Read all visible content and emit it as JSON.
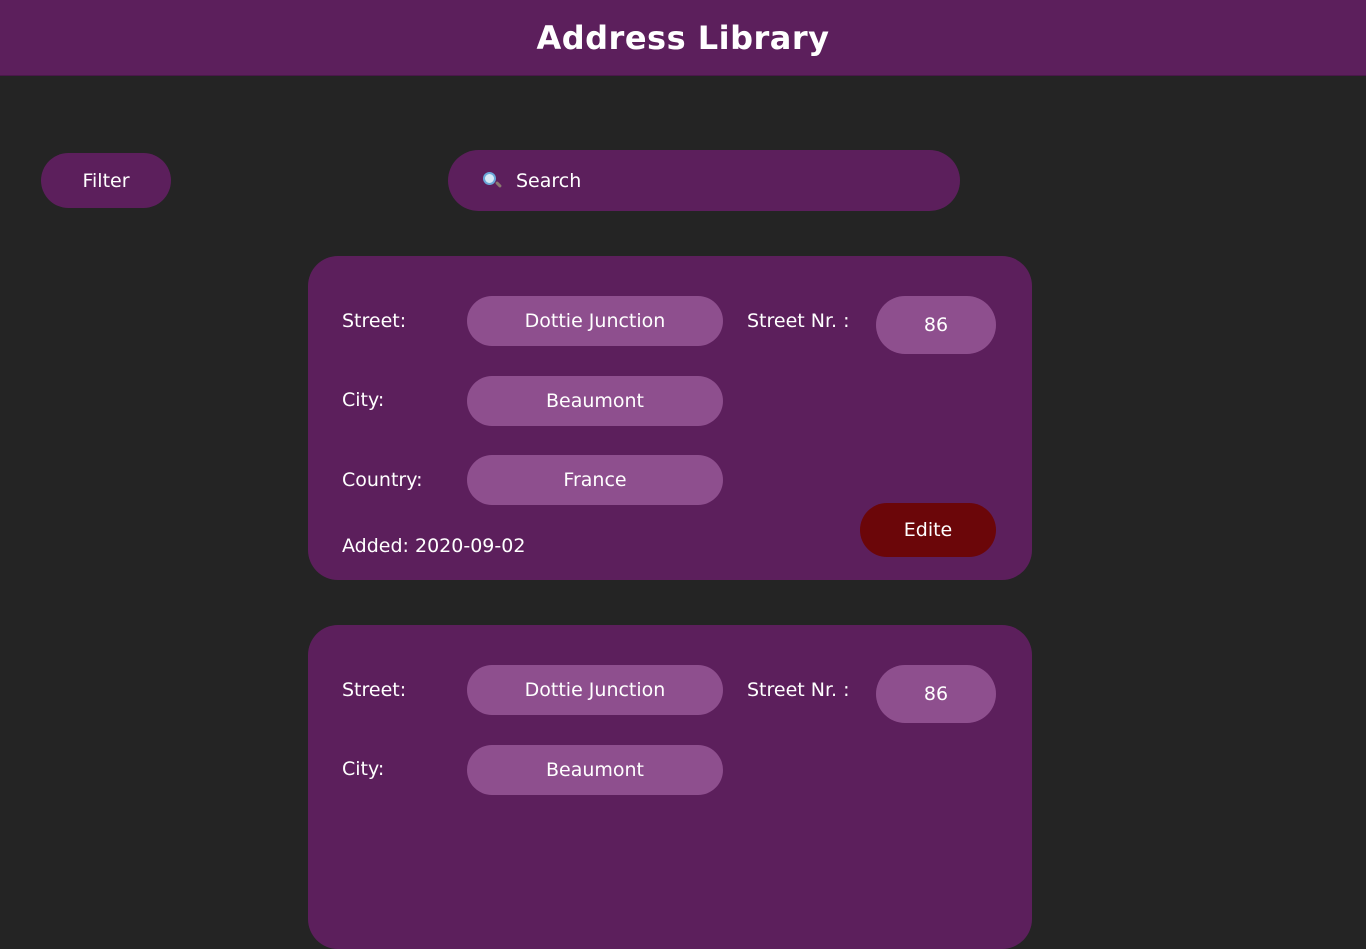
{
  "header": {
    "title": "Address Library"
  },
  "toolbar": {
    "filter_label": "Filter",
    "search_placeholder": "Search",
    "search_icon": "search-icon"
  },
  "colors": {
    "background": "#242424",
    "primary_purple": "#5c1f5c",
    "field_purple": "#8e4f8e",
    "edit_red": "#6b0609",
    "text": "#ffffff"
  },
  "labels": {
    "street": "Street:",
    "street_nr": "Street Nr. :",
    "city": "City:",
    "country": "Country:",
    "added_prefix": "Added:"
  },
  "addresses": [
    {
      "street": "Dottie Junction",
      "street_nr": "86",
      "city": "Beaumont",
      "country": "France",
      "added": "2020-09-02",
      "edit_label": "Edite"
    },
    {
      "street": "Dottie Junction",
      "street_nr": "86",
      "city": "Beaumont"
    }
  ]
}
